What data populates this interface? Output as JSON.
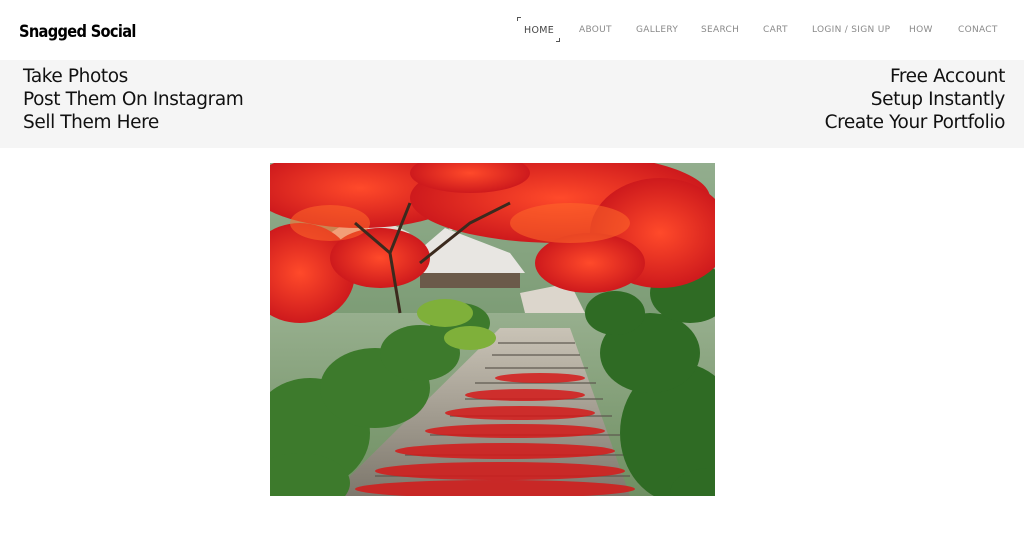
{
  "brand": {
    "logo_text": "Snagged Social"
  },
  "nav": {
    "items": [
      {
        "label": "HOME",
        "active": true
      },
      {
        "label": "ABOUT",
        "active": false
      },
      {
        "label": "GALLERY",
        "active": false
      },
      {
        "label": "SEARCH",
        "active": false
      },
      {
        "label": "CART",
        "active": false
      },
      {
        "label": "LOGIN / SIGN UP",
        "active": false
      },
      {
        "label": "HOW",
        "active": false
      },
      {
        "label": "CONACT",
        "active": false
      }
    ]
  },
  "banner": {
    "left_lines": [
      "Take Photos",
      "Post Them On Instagram",
      "Sell Them Here"
    ],
    "right_lines": [
      "Free Account",
      "Setup Instantly",
      "Create Your Portfolio"
    ]
  },
  "hero_image": {
    "subject": "autumn-garden-stairway",
    "colors": {
      "foliage": "#d81e1e",
      "shrubs": "#3f7a2e",
      "stone": "#8a8478"
    }
  }
}
